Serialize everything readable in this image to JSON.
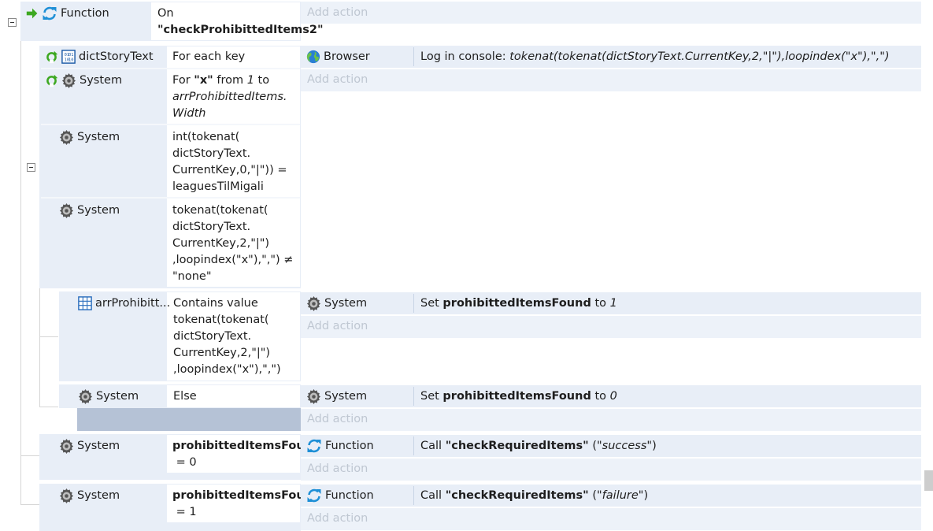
{
  "event_root": {
    "object": "Function",
    "cond_line1": "On",
    "cond_line2": "\"checkProhibittedItems2\"",
    "add_action": "Add action"
  },
  "loop_key": {
    "object": "dictStoryText",
    "condition": "For each key",
    "action_object": "Browser",
    "action_prefix": "Log in console: ",
    "action_expr": "tokenat(tokenat(dictStoryText.CurrentKey,2,\"|\"),loopindex(\"x\"),\",\")"
  },
  "loop_x": {
    "object": "System",
    "line1_prefix": "For ",
    "line1_var": "\"x\"",
    "line1_mid": " from ",
    "line1_num": "1",
    "line1_suffix": " to",
    "line2": "arrProhibittedItems.",
    "line3": "Width",
    "add_action": "Add action"
  },
  "compare1": {
    "object": "System",
    "lines": [
      "int(tokenat(",
      "dictStoryText.",
      "CurrentKey,0,\"|\")) =",
      "leaguesTilMigali"
    ]
  },
  "compare2": {
    "object": "System",
    "lines": [
      "tokenat(tokenat(",
      "dictStoryText.",
      "CurrentKey,2,\"|\")",
      ",loopindex(\"x\"),\",\") ≠",
      "\"none\""
    ]
  },
  "contains": {
    "object": "arrProhibitt...",
    "lines": [
      "Contains value",
      "tokenat(tokenat(",
      "dictStoryText.",
      "CurrentKey,2,\"|\")",
      ",loopindex(\"x\"),\",\")"
    ],
    "action_object": "System",
    "action_prefix": "Set ",
    "action_var": "prohibittedItemsFound",
    "action_mid": " to ",
    "action_value": "1",
    "add_action": "Add action"
  },
  "else_event": {
    "object": "System",
    "condition": "Else",
    "action_object": "System",
    "action_prefix": "Set ",
    "action_var": "prohibittedItemsFound",
    "action_mid": " to ",
    "action_value": "0",
    "add_action": "Add action"
  },
  "found0": {
    "object": "System",
    "line1": "prohibittedItemsFour",
    "line2": " = 0",
    "action_object": "Function",
    "action_prefix": "Call ",
    "action_name": "\"checkRequiredItems\"",
    "action_open": " (",
    "action_arg": "\"success\"",
    "action_close": ")",
    "add_action": "Add action"
  },
  "found1": {
    "object": "System",
    "line1": "prohibittedItemsFour",
    "line2": " = 1",
    "action_object": "Function",
    "action_prefix": "Call ",
    "action_name": "\"checkRequiredItems\"",
    "action_open": " (",
    "action_arg": "\"failure\"",
    "action_close": ")",
    "add_action": "Add action"
  },
  "colors": {
    "condition_bg": "#e8eef7",
    "add_action_text": "#bfc7d2",
    "function_icon": "#1e8fd6",
    "trigger_arrow": "#3da821",
    "loop_icon": "#3da821"
  },
  "icons": {
    "trigger": "green-arrow-icon",
    "function": "function-refresh-icon",
    "system": "gear-icon",
    "dictionary": "dictionary-icon",
    "browser": "globe-icon",
    "array": "grid-icon",
    "loop": "loop-icon"
  }
}
